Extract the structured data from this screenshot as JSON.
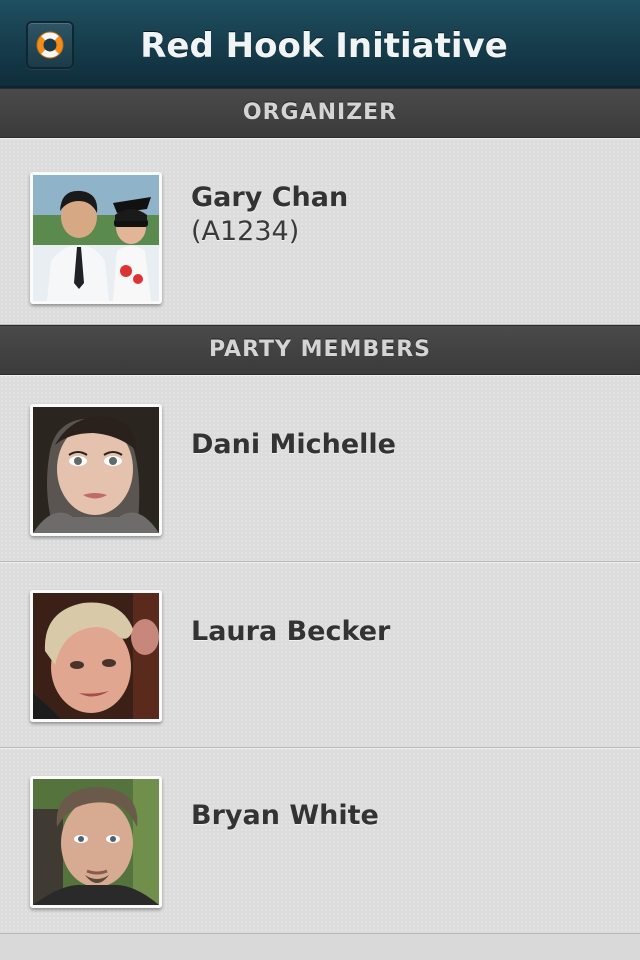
{
  "navbar": {
    "title": "Red Hook Initiative",
    "help_icon": "lifebuoy-icon",
    "background_color": "#163c4b",
    "accent_color": "#f28c1a"
  },
  "organizer_section": {
    "header": "ORGANIZER",
    "organizer": {
      "name": "Gary Chan",
      "id": "(A1234)",
      "avatar": "photo-of-man-with-child-icon"
    }
  },
  "party_section": {
    "header": "PARTY MEMBERS",
    "members": [
      {
        "name": "Dani Michelle",
        "avatar": "photo-of-woman-dark-hair-icon"
      },
      {
        "name": "Laura Becker",
        "avatar": "photo-of-woman-blonde-short-hair-icon"
      },
      {
        "name": "Bryan White",
        "avatar": "photo-of-man-goatee-icon"
      }
    ]
  }
}
